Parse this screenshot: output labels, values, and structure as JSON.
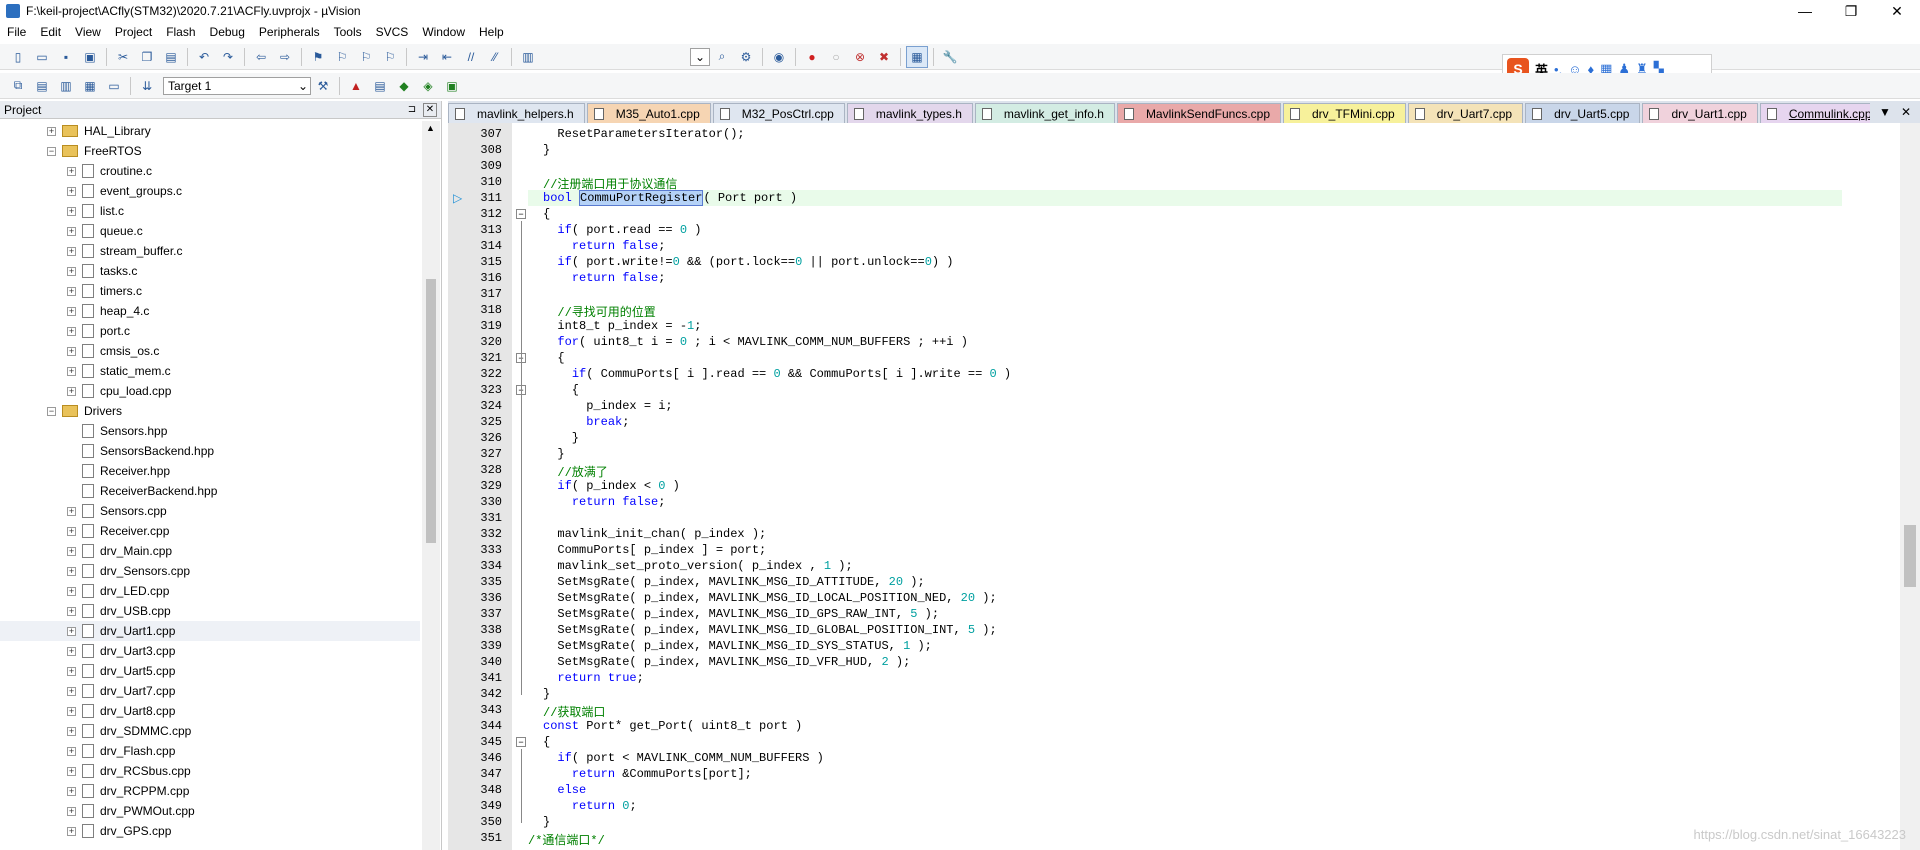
{
  "window": {
    "title": "F:\\keil-project\\ACfly(STM32)\\2020.7.21\\ACFly.uvprojx - µVision",
    "controls": [
      "—",
      "❐",
      "✕"
    ]
  },
  "menu": [
    "File",
    "Edit",
    "View",
    "Project",
    "Flash",
    "Debug",
    "Peripherals",
    "Tools",
    "SVCS",
    "Window",
    "Help"
  ],
  "toolbar2": {
    "target": "Target 1"
  },
  "ime": {
    "lang": "英"
  },
  "project_panel": {
    "title": "Project",
    "pin": "⊐",
    "close": "✕",
    "items": [
      {
        "label": "HAL_Library",
        "kind": "folder",
        "toggle": "+"
      },
      {
        "label": "FreeRTOS",
        "kind": "folder",
        "toggle": "−"
      },
      {
        "label": "croutine.c",
        "kind": "file",
        "toggle": "+"
      },
      {
        "label": "event_groups.c",
        "kind": "file",
        "toggle": "+"
      },
      {
        "label": "list.c",
        "kind": "file",
        "toggle": "+"
      },
      {
        "label": "queue.c",
        "kind": "file",
        "toggle": "+"
      },
      {
        "label": "stream_buffer.c",
        "kind": "file",
        "toggle": "+"
      },
      {
        "label": "tasks.c",
        "kind": "file",
        "toggle": "+"
      },
      {
        "label": "timers.c",
        "kind": "file",
        "toggle": "+"
      },
      {
        "label": "heap_4.c",
        "kind": "file",
        "toggle": "+"
      },
      {
        "label": "port.c",
        "kind": "file",
        "toggle": "+"
      },
      {
        "label": "cmsis_os.c",
        "kind": "file",
        "toggle": "+"
      },
      {
        "label": "static_mem.c",
        "kind": "file",
        "toggle": "+"
      },
      {
        "label": "cpu_load.cpp",
        "kind": "file",
        "toggle": "+"
      },
      {
        "label": "Drivers",
        "kind": "folder",
        "toggle": "−"
      },
      {
        "label": "Sensors.hpp",
        "kind": "file",
        "toggle": ""
      },
      {
        "label": "SensorsBackend.hpp",
        "kind": "file",
        "toggle": ""
      },
      {
        "label": "Receiver.hpp",
        "kind": "file",
        "toggle": ""
      },
      {
        "label": "ReceiverBackend.hpp",
        "kind": "file",
        "toggle": ""
      },
      {
        "label": "Sensors.cpp",
        "kind": "file",
        "toggle": "+"
      },
      {
        "label": "Receiver.cpp",
        "kind": "file",
        "toggle": "+"
      },
      {
        "label": "drv_Main.cpp",
        "kind": "file",
        "toggle": "+"
      },
      {
        "label": "drv_Sensors.cpp",
        "kind": "file",
        "toggle": "+"
      },
      {
        "label": "drv_LED.cpp",
        "kind": "file",
        "toggle": "+"
      },
      {
        "label": "drv_USB.cpp",
        "kind": "file",
        "toggle": "+"
      },
      {
        "label": "drv_Uart1.cpp",
        "kind": "file",
        "toggle": "+",
        "selected": true
      },
      {
        "label": "drv_Uart3.cpp",
        "kind": "file",
        "toggle": "+"
      },
      {
        "label": "drv_Uart5.cpp",
        "kind": "file",
        "toggle": "+"
      },
      {
        "label": "drv_Uart7.cpp",
        "kind": "file",
        "toggle": "+"
      },
      {
        "label": "drv_Uart8.cpp",
        "kind": "file",
        "toggle": "+"
      },
      {
        "label": "drv_SDMMC.cpp",
        "kind": "file",
        "toggle": "+"
      },
      {
        "label": "drv_Flash.cpp",
        "kind": "file",
        "toggle": "+"
      },
      {
        "label": "drv_RCSbus.cpp",
        "kind": "file",
        "toggle": "+"
      },
      {
        "label": "drv_RCPPM.cpp",
        "kind": "file",
        "toggle": "+"
      },
      {
        "label": "drv_PWMOut.cpp",
        "kind": "file",
        "toggle": "+"
      },
      {
        "label": "drv_GPS.cpp",
        "kind": "file",
        "toggle": "+"
      }
    ]
  },
  "tabs": [
    {
      "label": "mavlink_helpers.h",
      "color": "#dfe6f0"
    },
    {
      "label": "M35_Auto1.cpp",
      "color": "#f6d5b3"
    },
    {
      "label": "M32_PosCtrl.cpp",
      "color": "#dfe6f0"
    },
    {
      "label": "mavlink_types.h",
      "color": "#e3d7ec"
    },
    {
      "label": "mavlink_get_info.h",
      "color": "#d3ece3"
    },
    {
      "label": "MavlinkSendFuncs.cpp",
      "color": "#e9a9a9"
    },
    {
      "label": "drv_TFMini.cpp",
      "color": "#f7f19b"
    },
    {
      "label": "drv_Uart7.cpp",
      "color": "#f4e3b8"
    },
    {
      "label": "drv_Uart5.cpp",
      "color": "#c9d6e9"
    },
    {
      "label": "drv_Uart1.cpp",
      "color": "#f0d2dc"
    },
    {
      "label": "Commulink.cpp",
      "color": "#e6d5ef",
      "active": true
    }
  ],
  "tab_controls": [
    "▼",
    "✕"
  ],
  "code_lines": [
    {
      "n": "307",
      "html": "  ResetParametersIterator();"
    },
    {
      "n": "308",
      "html": "}"
    },
    {
      "n": "309",
      "html": ""
    },
    {
      "n": "310",
      "html": "<span class=\"cm\">//注册端口用于协议通信</span>"
    },
    {
      "n": "311",
      "html": "<span class=\"kw\">bool</span> <span class=\"sel-word\">CommuPortRegister</span>( Port port )",
      "current": true
    },
    {
      "n": "312",
      "html": "{",
      "fold": "−"
    },
    {
      "n": "313",
      "html": "  <span class=\"kw\">if</span>( port.read == <span class=\"num\">0</span> )"
    },
    {
      "n": "314",
      "html": "    <span class=\"kw\">return</span> <span class=\"kw\">false</span>;"
    },
    {
      "n": "315",
      "html": "  <span class=\"kw\">if</span>( port.write!=<span class=\"num\">0</span> &amp;&amp; (port.lock==<span class=\"num\">0</span> || port.unlock==<span class=\"num\">0</span>) )"
    },
    {
      "n": "316",
      "html": "    <span class=\"kw\">return</span> <span class=\"kw\">false</span>;"
    },
    {
      "n": "317",
      "html": ""
    },
    {
      "n": "318",
      "html": "  <span class=\"cm\">//寻找可用的位置</span>"
    },
    {
      "n": "319",
      "html": "  int8_t p_index = -<span class=\"num\">1</span>;"
    },
    {
      "n": "320",
      "html": "  <span class=\"kw\">for</span>( uint8_t i = <span class=\"num\">0</span> ; i &lt; MAVLINK_COMM_NUM_BUFFERS ; ++i )"
    },
    {
      "n": "321",
      "html": "  {",
      "fold": "−"
    },
    {
      "n": "322",
      "html": "    <span class=\"kw\">if</span>( CommuPorts[ i ].read == <span class=\"num\">0</span> &amp;&amp; CommuPorts[ i ].write == <span class=\"num\">0</span> )"
    },
    {
      "n": "323",
      "html": "    {",
      "fold": "−"
    },
    {
      "n": "324",
      "html": "      p_index = i;"
    },
    {
      "n": "325",
      "html": "      <span class=\"kw\">break</span>;"
    },
    {
      "n": "326",
      "html": "    }"
    },
    {
      "n": "327",
      "html": "  }"
    },
    {
      "n": "328",
      "html": "  <span class=\"cm\">//放满了</span>"
    },
    {
      "n": "329",
      "html": "  <span class=\"kw\">if</span>( p_index &lt; <span class=\"num\">0</span> )"
    },
    {
      "n": "330",
      "html": "    <span class=\"kw\">return</span> <span class=\"kw\">false</span>;"
    },
    {
      "n": "331",
      "html": ""
    },
    {
      "n": "332",
      "html": "  mavlink_init_chan( p_index );"
    },
    {
      "n": "333",
      "html": "  CommuPorts[ p_index ] = port;"
    },
    {
      "n": "334",
      "html": "  mavlink_set_proto_version( p_index , <span class=\"num\">1</span> );"
    },
    {
      "n": "335",
      "html": "  SetMsgRate( p_index, MAVLINK_MSG_ID_ATTITUDE, <span class=\"num\">20</span> );"
    },
    {
      "n": "336",
      "html": "  SetMsgRate( p_index, MAVLINK_MSG_ID_LOCAL_POSITION_NED, <span class=\"num\">20</span> );"
    },
    {
      "n": "337",
      "html": "  SetMsgRate( p_index, MAVLINK_MSG_ID_GPS_RAW_INT, <span class=\"num\">5</span> );"
    },
    {
      "n": "338",
      "html": "  SetMsgRate( p_index, MAVLINK_MSG_ID_GLOBAL_POSITION_INT, <span class=\"num\">5</span> );"
    },
    {
      "n": "339",
      "html": "  SetMsgRate( p_index, MAVLINK_MSG_ID_SYS_STATUS, <span class=\"num\">1</span> );"
    },
    {
      "n": "340",
      "html": "  SetMsgRate( p_index, MAVLINK_MSG_ID_VFR_HUD, <span class=\"num\">2</span> );"
    },
    {
      "n": "341",
      "html": "  <span class=\"kw\">return</span> <span class=\"kw\">true</span>;"
    },
    {
      "n": "342",
      "html": "}"
    },
    {
      "n": "343",
      "html": "<span class=\"cm\">//获取端口</span>"
    },
    {
      "n": "344",
      "html": "<span class=\"kw\">const</span> Port* get_Port( uint8_t port )"
    },
    {
      "n": "345",
      "html": "{",
      "fold": "−"
    },
    {
      "n": "346",
      "html": "  <span class=\"kw\">if</span>( port &lt; MAVLINK_COMM_NUM_BUFFERS )"
    },
    {
      "n": "347",
      "html": "    <span class=\"kw\">return</span> &amp;CommuPorts[port];"
    },
    {
      "n": "348",
      "html": "  <span class=\"kw\">else</span>"
    },
    {
      "n": "349",
      "html": "    <span class=\"kw\">return</span> <span class=\"num\">0</span>;"
    },
    {
      "n": "350",
      "html": "}"
    },
    {
      "n": "351",
      "html": "<span class=\"cm\">/*通信端口*/</span>",
      "outdent": true
    }
  ],
  "watermark": "https://blog.csdn.net/sinat_16643223"
}
